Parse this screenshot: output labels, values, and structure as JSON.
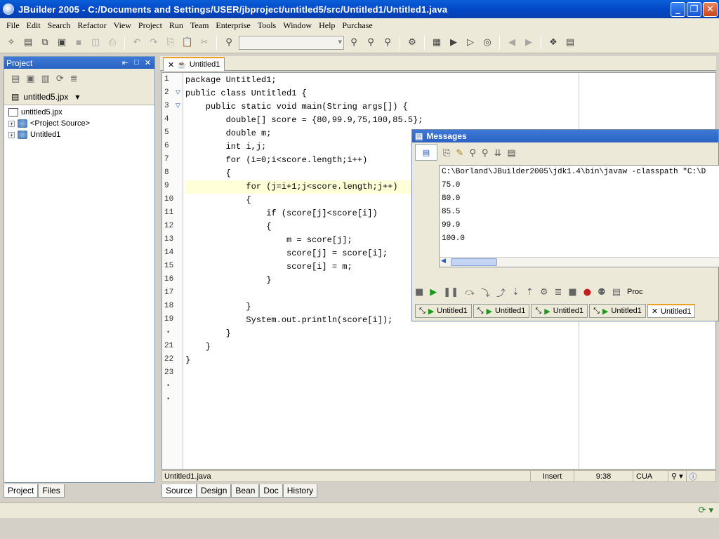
{
  "window": {
    "title": "JBuilder 2005 - C:/Documents and Settings/USER/jbproject/untitled5/src/Untitled1/Untitled1.java"
  },
  "menu": [
    "File",
    "Edit",
    "Search",
    "Refactor",
    "View",
    "Project",
    "Run",
    "Team",
    "Enterprise",
    "Tools",
    "Window",
    "Help",
    "Purchase"
  ],
  "project_panel": {
    "title": "Project",
    "selected_project": "untitled5.jpx",
    "tree": [
      "untitled5.jpx",
      "<Project Source>",
      "Untitled1"
    ],
    "bottom_tabs": [
      "Project",
      "Files"
    ]
  },
  "editor": {
    "tab": "Untitled1",
    "lines": [
      "1",
      "2",
      "3",
      "4",
      "5",
      "6",
      "7",
      "8",
      "9",
      "10",
      "11",
      "12",
      "13",
      "14",
      "15",
      "16",
      "17",
      "18",
      "19",
      "",
      "21",
      "22",
      "23",
      "",
      ""
    ],
    "code": [
      "package Untitled1;",
      "public class Untitled1 {",
      "    public static void main(String args[]) {",
      "        double[] score = {80,99.9,75,100,85.5};",
      "        double m;",
      "        int i,j;",
      "        for (i=0;i<score.length;i++)",
      "        {",
      "            for (j=i+1;j<score.length;j++)",
      "            {",
      "                if (score[j]<score[i])",
      "                {",
      "                    m = score[j];",
      "                    score[j] = score[i];",
      "                    score[i] = m;",
      "                }",
      "",
      "            }",
      "            System.out.println(score[i]);",
      "        }",
      "    }",
      "}"
    ],
    "status": {
      "file": "Untitled1.java",
      "mode": "Insert",
      "position": "9:38",
      "keymap": "CUA"
    },
    "bottom_tabs": [
      "Source",
      "Design",
      "Bean",
      "Doc",
      "History"
    ]
  },
  "messages": {
    "title": "Messages",
    "output": [
      "C:\\Borland\\JBuilder2005\\jdk1.4\\bin\\javaw -classpath \"C:\\D",
      "75.0",
      "80.0",
      "85.5",
      "99.9",
      "100.0"
    ],
    "ctrl_label": "Proc",
    "tabs": [
      "Untitled1",
      "Untitled1",
      "Untitled1",
      "Untitled1",
      "Untitled1"
    ]
  }
}
